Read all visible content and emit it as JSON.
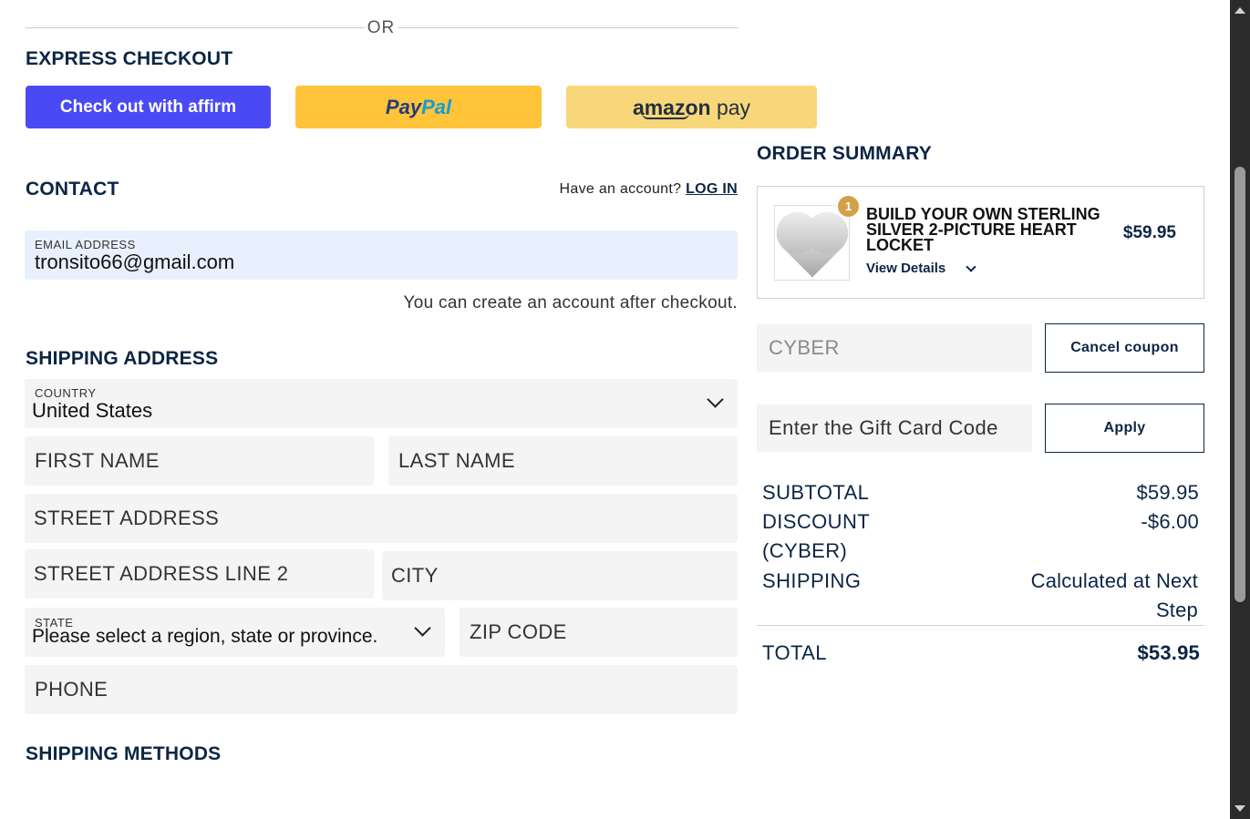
{
  "divider": {
    "or_text": "OR"
  },
  "express": {
    "title": "EXPRESS CHECKOUT",
    "affirm_label": "Check out with affirm",
    "paypal_part1": "Pay",
    "paypal_part2": "Pal",
    "amazon_part1": "amazon",
    "amazon_part2": " pay"
  },
  "contact": {
    "title": "CONTACT",
    "have_account": "Have an account? ",
    "login_link": "LOG IN",
    "email_label": "EMAIL ADDRESS",
    "email_value": "tronsito66@gmail.com",
    "create_note": "You can create an account after checkout."
  },
  "shipping": {
    "title": "SHIPPING ADDRESS",
    "country_label": "COUNTRY",
    "country_value": "United States",
    "first_name": "FIRST NAME",
    "last_name": "LAST NAME",
    "street": "STREET ADDRESS",
    "street2": "STREET ADDRESS LINE 2",
    "city": "CITY",
    "state_label": "STATE",
    "state_value": "Please select a region, state or province.",
    "zip": "ZIP CODE",
    "phone": "PHONE",
    "methods_title": "SHIPPING METHODS"
  },
  "summary": {
    "title": "ORDER SUMMARY",
    "product": {
      "qty": "1",
      "name": "BUILD YOUR OWN STERLING SILVER 2-PICTURE HEART LOCKET",
      "view_details": "View Details",
      "price": "$59.95"
    },
    "coupon_value": "CYBER",
    "cancel_coupon": "Cancel coupon",
    "gift_placeholder": "Enter the Gift Card Code",
    "apply": "Apply",
    "subtotal_label": "SUBTOTAL",
    "subtotal_value": "$59.95",
    "discount_label1": "DISCOUNT",
    "discount_label2": "(CYBER)",
    "discount_value": "-$6.00",
    "shipping_label": "SHIPPING",
    "shipping_value1": "Calculated at Next",
    "shipping_value2": "Step",
    "total_label": "TOTAL",
    "total_value": "$53.95"
  },
  "colors": {
    "navy": "#0c2545",
    "affirm": "#4a4af4",
    "paypal": "#ffc439",
    "amazon": "#f8d77a",
    "badge": "#d5a04a"
  }
}
